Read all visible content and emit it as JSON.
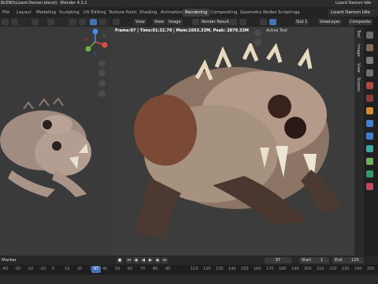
{
  "title": {
    "left": "BLEND\\Lizard Demon.blend] - Blender 4.3.2",
    "right": "Lizard Demon Idle"
  },
  "workspace_tabs": [
    {
      "label": "File",
      "active": false
    },
    {
      "label": "Layout",
      "active": false
    },
    {
      "label": "Modeling",
      "active": false
    },
    {
      "label": "Sculpting",
      "active": false
    },
    {
      "label": "UV Editing",
      "active": false
    },
    {
      "label": "Texture Paint",
      "active": false
    },
    {
      "label": "Shading",
      "active": false
    },
    {
      "label": "Animation",
      "active": false
    },
    {
      "label": "Rendering",
      "active": true
    },
    {
      "label": "Compositing",
      "active": false
    },
    {
      "label": "Geometry Nodes",
      "active": false
    },
    {
      "label": "Scripting",
      "active": false
    }
  ],
  "tab_add": "+",
  "scene_name": "Lizard Demon Idle",
  "render_header": {
    "view": "View",
    "view2": "View",
    "image": "Image",
    "render_result": "Render Result",
    "slot": "Slot 1",
    "view_layer": "ViewLayer",
    "composite": "Composite"
  },
  "render_stats": "Frame:97 | Time:01:32.79 | Mem:1663.33M, Peak: 2879.33M",
  "active_tool": "Active Tool",
  "side_tabs": [
    "Tool",
    "Image",
    "View",
    "Scopes"
  ],
  "timeline": {
    "marker": "Marker",
    "current_frame": "97",
    "start_label": "Start",
    "start_value": "1",
    "end_label": "End",
    "end_value": "120",
    "ticks": [
      "-40",
      "-30",
      "-20",
      "-10",
      "0",
      "10",
      "20",
      "30",
      "40",
      "50",
      "60",
      "70",
      "80",
      "90",
      "97",
      "110",
      "120",
      "130",
      "140",
      "150",
      "160",
      "170",
      "180",
      "190",
      "200",
      "210",
      "220",
      "230",
      "240",
      "250"
    ]
  },
  "colors": {
    "accent": "#4772b3",
    "gizmo_x": "#e24a4a",
    "gizmo_y": "#6ab04c",
    "gizmo_z": "#4a8de2"
  }
}
